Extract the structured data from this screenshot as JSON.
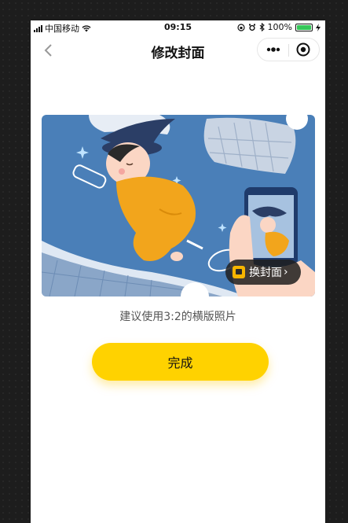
{
  "status_bar": {
    "carrier": "中国移动",
    "time": "09:15",
    "battery": "100%"
  },
  "nav": {
    "title": "修改封面"
  },
  "cover": {
    "change_label": "换封面"
  },
  "hint": "建议使用3:2的横版照片",
  "done_label": "完成",
  "colors": {
    "accent": "#ffd200",
    "cover_bg": "#4a7fb8",
    "figure_yellow": "#f2a51c",
    "hat": "#2b3e66"
  },
  "icons": [
    "signal-icon",
    "wifi-icon",
    "lock-rotation-icon",
    "alarm-icon",
    "bluetooth-icon",
    "battery-icon",
    "charging-icon",
    "back-chevron-icon",
    "more-dots-icon",
    "close-target-icon",
    "image-icon",
    "chevron-right-icon"
  ]
}
